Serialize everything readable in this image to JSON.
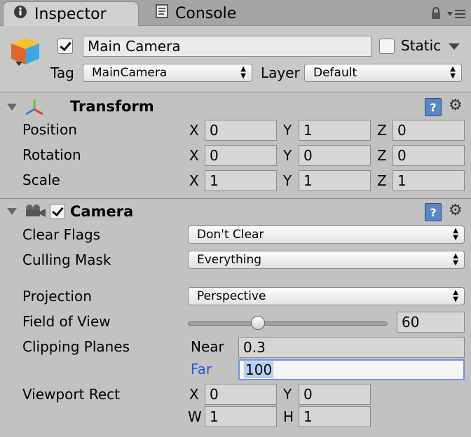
{
  "tabs": [
    {
      "label": "Inspector",
      "icon": "info-icon",
      "active": true
    },
    {
      "label": "Console",
      "icon": "console-icon",
      "active": false
    }
  ],
  "object": {
    "active": true,
    "name": "Main Camera",
    "static_label": "Static",
    "static_checked": false,
    "tag_label": "Tag",
    "tag_value": "MainCamera",
    "layer_label": "Layer",
    "layer_value": "Default"
  },
  "transform": {
    "title": "Transform",
    "rows": [
      {
        "label": "Position",
        "x": "0",
        "y": "1",
        "z": "0"
      },
      {
        "label": "Rotation",
        "x": "0",
        "y": "0",
        "z": "0"
      },
      {
        "label": "Scale",
        "x": "1",
        "y": "1",
        "z": "1"
      }
    ],
    "axis_x": "X",
    "axis_y": "Y",
    "axis_z": "Z"
  },
  "camera": {
    "title": "Camera",
    "enabled": true,
    "clear_flags_label": "Clear Flags",
    "clear_flags_value": "Don't Clear",
    "culling_mask_label": "Culling Mask",
    "culling_mask_value": "Everything",
    "projection_label": "Projection",
    "projection_value": "Perspective",
    "fov_label": "Field of View",
    "fov_value": "60",
    "fov_fraction": 0.34,
    "clipping_label": "Clipping Planes",
    "near_label": "Near",
    "near_value": "0.3",
    "far_label": "Far",
    "far_value": "100",
    "viewport_label": "Viewport Rect",
    "vp_x_label": "X",
    "vp_x": "0",
    "vp_y_label": "Y",
    "vp_y": "0",
    "vp_w_label": "W",
    "vp_w": "1",
    "vp_h_label": "H",
    "vp_h": "1"
  },
  "colors": {
    "accent": "#2a5bd7",
    "selection": "#b8cef5"
  }
}
